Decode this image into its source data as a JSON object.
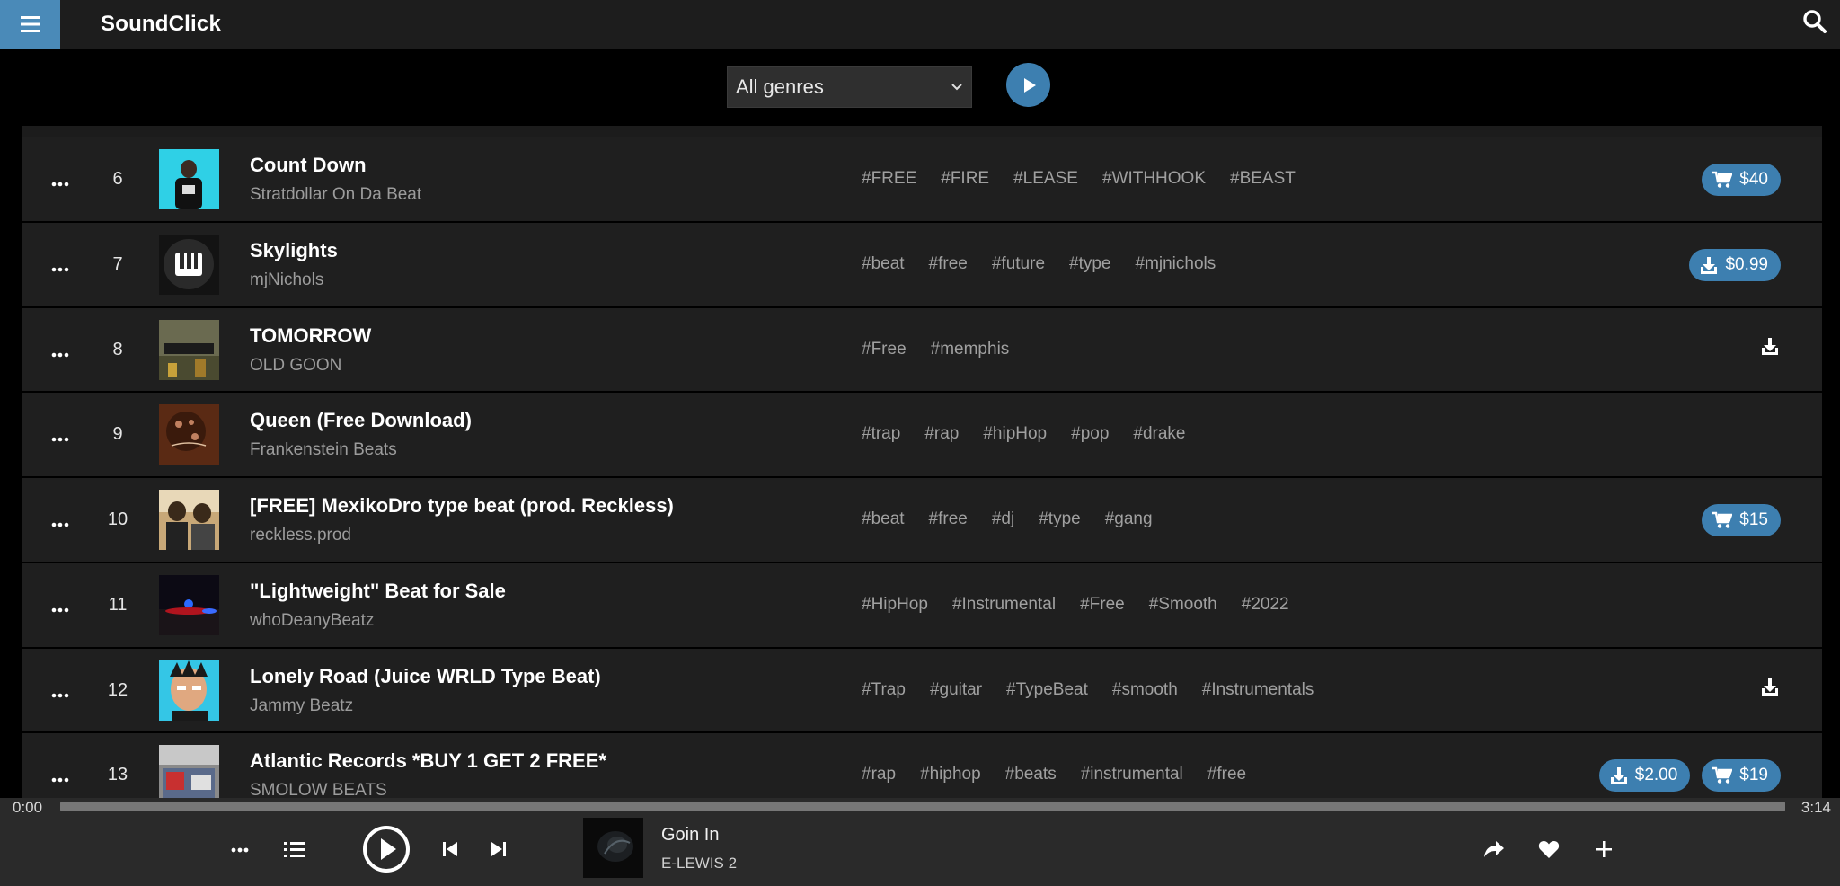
{
  "app": {
    "brand": "SoundClick"
  },
  "filter": {
    "genre_selected": "All genres"
  },
  "tracks": [
    {
      "rank": "6",
      "title": "Count Down",
      "artist": "Stratdollar On Da Beat",
      "tags": [
        "#FREE",
        "#FIRE",
        "#LEASE",
        "#WITHHOOK",
        "#BEAST"
      ],
      "actions": [
        {
          "kind": "cart",
          "label": "$40"
        }
      ]
    },
    {
      "rank": "7",
      "title": "Skylights",
      "artist": "mjNichols",
      "tags": [
        "#beat",
        "#free",
        "#future",
        "#type",
        "#mjnichols"
      ],
      "actions": [
        {
          "kind": "download",
          "label": "$0.99"
        }
      ]
    },
    {
      "rank": "8",
      "title": "TOMORROW",
      "artist": "OLD GOON",
      "tags": [
        "#Free",
        "#memphis"
      ],
      "actions": [
        {
          "kind": "download-icon",
          "label": ""
        }
      ]
    },
    {
      "rank": "9",
      "title": "Queen (Free Download)",
      "artist": "Frankenstein Beats",
      "tags": [
        "#trap",
        "#rap",
        "#hipHop",
        "#pop",
        "#drake"
      ],
      "actions": []
    },
    {
      "rank": "10",
      "title": "[FREE] MexikoDro type beat (prod. Reckless)",
      "artist": "reckless.prod",
      "tags": [
        "#beat",
        "#free",
        "#dj",
        "#type",
        "#gang"
      ],
      "actions": [
        {
          "kind": "cart",
          "label": "$15"
        }
      ]
    },
    {
      "rank": "11",
      "title": "\"Lightweight\" Beat for Sale",
      "artist": "whoDeanyBeatz",
      "tags": [
        "#HipHop",
        "#Instrumental",
        "#Free",
        "#Smooth",
        "#2022"
      ],
      "actions": []
    },
    {
      "rank": "12",
      "title": "Lonely Road (Juice WRLD Type Beat)",
      "artist": "Jammy Beatz",
      "tags": [
        "#Trap",
        "#guitar",
        "#TypeBeat",
        "#smooth",
        "#Instrumentals"
      ],
      "actions": [
        {
          "kind": "download-icon",
          "label": ""
        }
      ]
    },
    {
      "rank": "13",
      "title": "Atlantic Records *BUY 1 GET 2 FREE*",
      "artist": "SMOLOW BEATS",
      "tags": [
        "#rap",
        "#hiphop",
        "#beats",
        "#instrumental",
        "#free"
      ],
      "actions": [
        {
          "kind": "download",
          "label": "$2.00"
        },
        {
          "kind": "cart",
          "label": "$19"
        }
      ]
    }
  ],
  "player": {
    "time_elapsed": "0:00",
    "time_total": "3:14",
    "progress": 0,
    "now_playing_title": "Goin In",
    "now_playing_artist": "E-LEWIS 2"
  },
  "colors": {
    "accent": "#3d7fb0",
    "menu": "#4a8ab8",
    "row_bg": "#1f1f1f",
    "topbar": "#1d1d1d"
  },
  "icons": {
    "menu": "hamburger-icon",
    "search": "search-icon",
    "play": "play-icon",
    "more": "more-dots-icon",
    "cart": "cart-icon",
    "download": "download-icon",
    "queue": "queue-list-icon",
    "prev": "skip-previous-icon",
    "next": "skip-next-icon",
    "share": "share-icon",
    "like": "heart-icon",
    "add": "plus-icon"
  }
}
